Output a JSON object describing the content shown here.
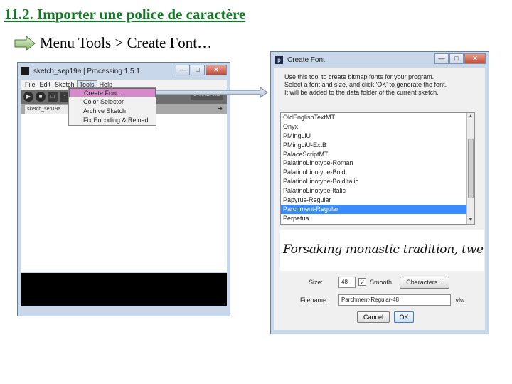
{
  "slide": {
    "title": "11.2. Importer une police de caractère",
    "bullet": "Menu Tools > Create Font…"
  },
  "colors": {
    "title": "#0f7a23",
    "menu_highlight": "#d68ac9",
    "selection": "#3a8bff"
  },
  "processing_window": {
    "title": "sketch_sep19a | Processing 1.5.1",
    "window_buttons": [
      "—",
      "□",
      "✕"
    ],
    "menus": [
      "File",
      "Edit",
      "Sketch",
      "Tools",
      "Help"
    ],
    "tab_label": "sketch_sep19a",
    "tab_arrow": "➔",
    "mode_tag": "STANDARD",
    "tools_menu_items": [
      "Create Font...",
      "Color Selector",
      "Archive Sketch",
      "Fix Encoding & Reload"
    ]
  },
  "create_font_dialog": {
    "icon_letter": "p",
    "title": "Create Font",
    "window_buttons": [
      "—",
      "□",
      "✕"
    ],
    "instructions": [
      "Use this tool to create bitmap fonts for your program.",
      "Select a font and size, and click 'OK' to generate the font.",
      "It will be added to the data folder of the current sketch."
    ],
    "fonts": [
      "OldEnglishTextMT",
      "Onyx",
      "PMingLiU",
      "PMingLiU-ExtB",
      "PalaceScriptMT",
      "PalatinoLinotype-Roman",
      "PalatinoLinotype-Bold",
      "PalatinoLinotype-BoldItalic",
      "PalatinoLinotype-Italic",
      "Papyrus-Regular",
      "Parchment-Regular",
      "Perpetua"
    ],
    "selected_font": "Parchment-Regular",
    "preview_text": "Forsaking monastic tradition, twelve jovial f",
    "size_label": "Size:",
    "size_value": "48",
    "smooth_checked": "✓",
    "smooth_label": "Smooth",
    "characters_button": "Characters...",
    "filename_label": "Filename:",
    "filename_value": "Parchment-Regular-48",
    "file_extension": ".vlw",
    "cancel_button": "Cancel",
    "ok_button": "OK"
  }
}
